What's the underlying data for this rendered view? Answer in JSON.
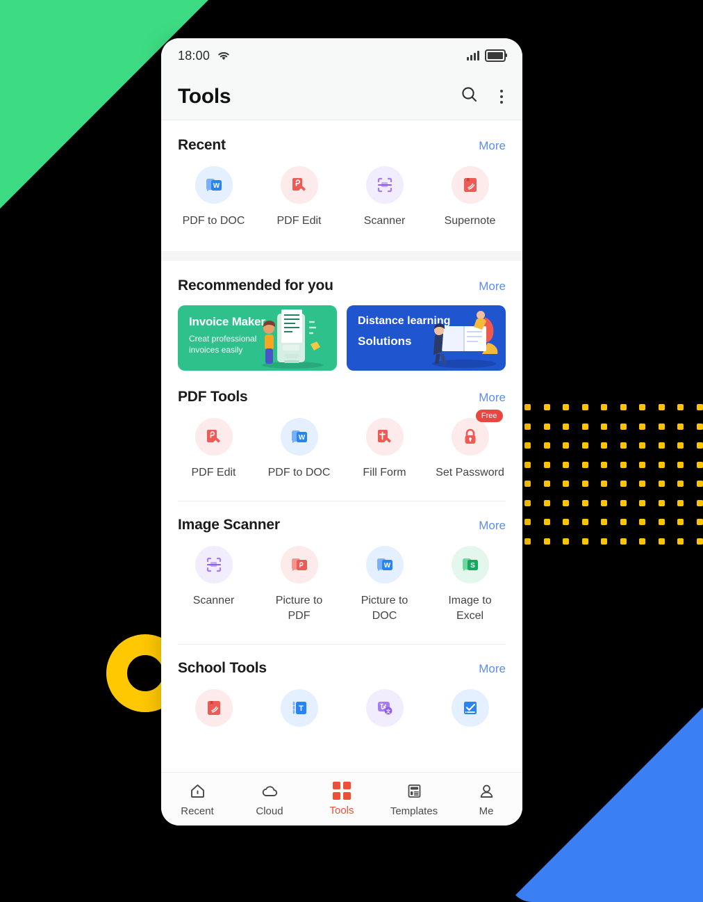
{
  "status_bar": {
    "time": "18:00",
    "wifi_icon": "wifi-icon",
    "signal_icon": "signal-bars-icon",
    "battery_icon": "battery-icon"
  },
  "app_bar": {
    "title": "Tools",
    "search_icon": "search-icon",
    "overflow_icon": "kebab-menu-icon"
  },
  "sections": [
    {
      "title": "Recent",
      "more_label": "More",
      "items": [
        {
          "label": "PDF to DOC",
          "icon": "pdf-to-doc-icon"
        },
        {
          "label": "PDF Edit",
          "icon": "pdf-edit-icon"
        },
        {
          "label": "Scanner",
          "icon": "scanner-icon"
        },
        {
          "label": "Supernote",
          "icon": "supernote-icon"
        }
      ]
    },
    {
      "title": "Recommended for you",
      "more_label": "More",
      "banners": [
        {
          "title": "Invoice Maker",
          "subtitle": "Creat professional\ninvoices easily",
          "color": "#2fc18c"
        },
        {
          "title": "Distance learning",
          "subtitle": "Solutions",
          "color": "#1f55cf"
        }
      ]
    },
    {
      "title": "PDF Tools",
      "more_label": "More",
      "items": [
        {
          "label": "PDF Edit",
          "icon": "pdf-edit-icon"
        },
        {
          "label": "PDF to DOC",
          "icon": "pdf-to-doc-icon"
        },
        {
          "label": "Fill Form",
          "icon": "fill-form-icon"
        },
        {
          "label": "Set Password",
          "icon": "lock-icon",
          "badge": "Free"
        }
      ]
    },
    {
      "title": "Image Scanner",
      "more_label": "More",
      "items": [
        {
          "label": "Scanner",
          "icon": "scanner-icon"
        },
        {
          "label": "Picture to PDF",
          "icon": "picture-to-pdf-icon"
        },
        {
          "label": "Picture to DOC",
          "icon": "picture-to-doc-icon"
        },
        {
          "label": "Image to Excel",
          "icon": "image-to-excel-icon"
        }
      ]
    },
    {
      "title": "School Tools",
      "more_label": "More",
      "items": [
        {
          "label": "",
          "icon": "supernote-icon"
        },
        {
          "label": "",
          "icon": "text-tool-icon"
        },
        {
          "label": "",
          "icon": "image-translate-icon"
        },
        {
          "label": "",
          "icon": "sign-checkmark-icon"
        }
      ]
    }
  ],
  "tab_bar": {
    "items": [
      {
        "label": "Recent",
        "icon": "home-icon",
        "active": false
      },
      {
        "label": "Cloud",
        "icon": "cloud-icon",
        "active": false
      },
      {
        "label": "Tools",
        "icon": "grid-icon",
        "active": true
      },
      {
        "label": "Templates",
        "icon": "templates-icon",
        "active": false
      },
      {
        "label": "Me",
        "icon": "person-icon",
        "active": false
      }
    ],
    "active_color": "#f04e36"
  },
  "decorations": {
    "green_triangle_color": "#3ddc84",
    "blue_triangle_color": "#3b7ff5",
    "yellow_ring_color": "#ffc800",
    "dot_grid_color": "#ffc400",
    "dot_grid_rows": 8,
    "dot_grid_cols": 10
  }
}
